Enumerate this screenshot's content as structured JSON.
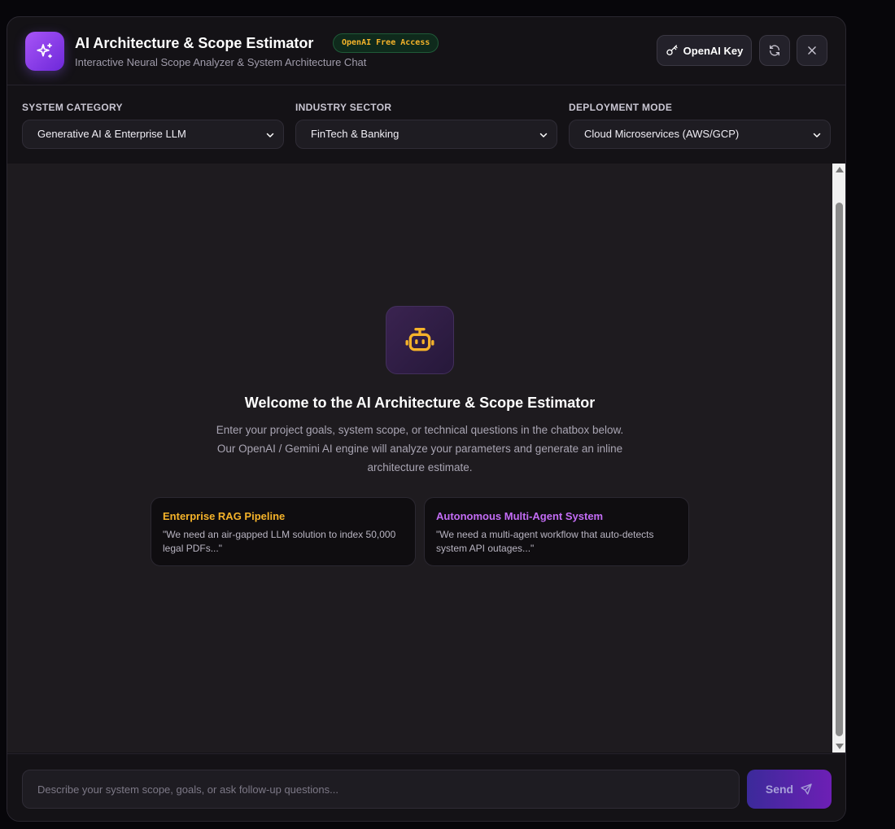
{
  "header": {
    "title": "AI Architecture & Scope Estimator",
    "badge": "OpenAI Free Access",
    "subtitle": "Interactive Neural Scope Analyzer & System Architecture Chat",
    "openai_key_label": "OpenAI Key",
    "icons": {
      "logo": "sparkles-icon",
      "key": "key-icon",
      "refresh": "refresh-icon",
      "close": "close-icon"
    }
  },
  "filters": [
    {
      "label": "SYSTEM CATEGORY",
      "value": "Generative AI & Enterprise LLM"
    },
    {
      "label": "INDUSTRY SECTOR",
      "value": "FinTech & Banking"
    },
    {
      "label": "DEPLOYMENT MODE",
      "value": "Cloud Microservices (AWS/GCP)"
    }
  ],
  "welcome": {
    "title": "Welcome to the AI Architecture & Scope Estimator",
    "description": "Enter your project goals, system scope, or technical questions in the chatbox below. Our OpenAI / Gemini AI engine will analyze your parameters and generate an inline architecture estimate.",
    "icon": "bot-icon"
  },
  "suggestions": [
    {
      "title": "Enterprise RAG Pipeline",
      "text": "\"We need an air-gapped LLM solution to index 50,000 legal PDFs...\""
    },
    {
      "title": "Autonomous Multi-Agent System",
      "text": "\"We need a multi-agent workflow that auto-detects system API outages...\""
    }
  ],
  "composer": {
    "placeholder": "Describe your system scope, goals, or ask follow-up questions...",
    "value": "",
    "send_label": "Send",
    "send_icon": "send-icon"
  },
  "colors": {
    "accent_purple": "#8b5cf6",
    "badge_text": "#f5b32a",
    "card1_title": "#f5b32a",
    "card2_title": "#c36cf5",
    "background": "#141216"
  }
}
